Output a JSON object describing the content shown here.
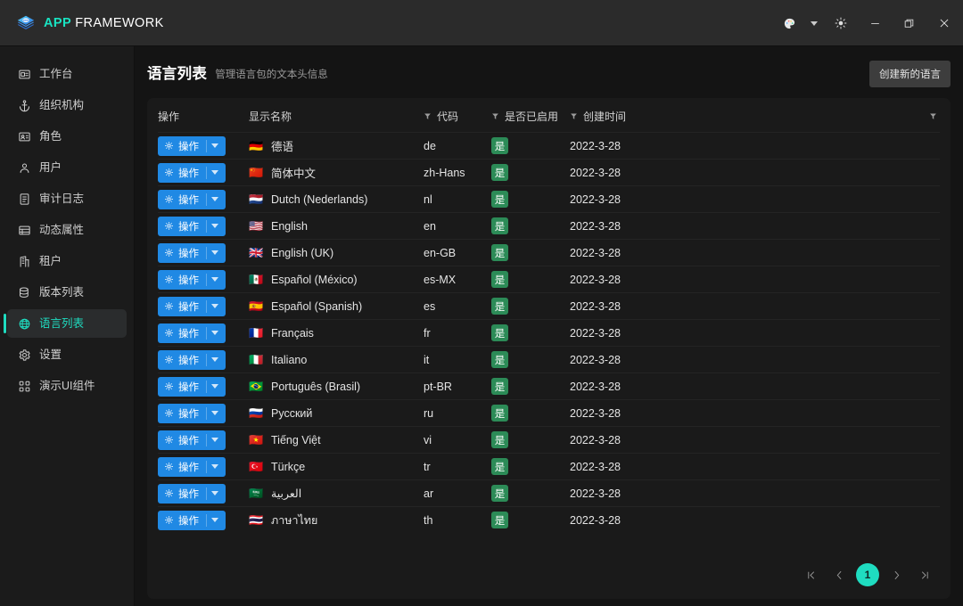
{
  "titlebar": {
    "brand_app": "APP",
    "brand_framework": "FRAMEWORK",
    "logo_icon": "layers-diamond-icon",
    "controls": [
      {
        "name": "theme-palette-button",
        "icon": "palette-icon"
      },
      {
        "name": "theme-palette-caret",
        "icon": "chevron-down-icon"
      },
      {
        "name": "brightness-button",
        "icon": "sun-icon"
      },
      {
        "name": "minimize-button",
        "icon": "minimize-icon"
      },
      {
        "name": "maximize-button",
        "icon": "maximize-icon"
      },
      {
        "name": "close-button",
        "icon": "close-icon"
      }
    ]
  },
  "sidebar": {
    "items": [
      {
        "label": "工作台",
        "icon": "dashboard-icon",
        "active": false
      },
      {
        "label": "组织机构",
        "icon": "anchor-icon",
        "active": false
      },
      {
        "label": "角色",
        "icon": "id-card-icon",
        "active": false
      },
      {
        "label": "用户",
        "icon": "user-icon",
        "active": false
      },
      {
        "label": "审计日志",
        "icon": "clipboard-icon",
        "active": false
      },
      {
        "label": "动态属性",
        "icon": "table-rows-icon",
        "active": false
      },
      {
        "label": "租户",
        "icon": "building-icon",
        "active": false
      },
      {
        "label": "版本列表",
        "icon": "database-icon",
        "active": false
      },
      {
        "label": "语言列表",
        "icon": "globe-icon",
        "active": true
      },
      {
        "label": "设置",
        "icon": "gear-icon",
        "active": false
      },
      {
        "label": "演示UI组件",
        "icon": "components-icon",
        "active": false
      }
    ]
  },
  "page": {
    "title": "语言列表",
    "subtitle": "管理语言包的文本头信息",
    "create_button": "创建新的语言"
  },
  "table": {
    "columns": [
      {
        "key": "action",
        "label": "操作",
        "filter": false
      },
      {
        "key": "name",
        "label": "显示名称",
        "filter": true
      },
      {
        "key": "code",
        "label": "代码",
        "filter": true
      },
      {
        "key": "enabled",
        "label": "是否已启用",
        "filter": true
      },
      {
        "key": "created",
        "label": "创建时间",
        "filter": false
      }
    ],
    "trailing_filter_icon": "filter-icon",
    "action_button": {
      "label": "操作",
      "icon": "gear-icon",
      "caret": "chevron-down-icon"
    },
    "rows": [
      {
        "flag": "🇩🇪",
        "name": "德语",
        "code": "de",
        "enabled": "是",
        "created": "2022-3-28"
      },
      {
        "flag": "🇨🇳",
        "name": "简体中文",
        "code": "zh-Hans",
        "enabled": "是",
        "created": "2022-3-28"
      },
      {
        "flag": "🇳🇱",
        "name": "Dutch (Nederlands)",
        "code": "nl",
        "enabled": "是",
        "created": "2022-3-28"
      },
      {
        "flag": "🇺🇸",
        "name": "English",
        "code": "en",
        "enabled": "是",
        "created": "2022-3-28"
      },
      {
        "flag": "🇬🇧",
        "name": "English (UK)",
        "code": "en-GB",
        "enabled": "是",
        "created": "2022-3-28"
      },
      {
        "flag": "🇲🇽",
        "name": "Español (México)",
        "code": "es-MX",
        "enabled": "是",
        "created": "2022-3-28"
      },
      {
        "flag": "🇪🇸",
        "name": "Español (Spanish)",
        "code": "es",
        "enabled": "是",
        "created": "2022-3-28"
      },
      {
        "flag": "🇫🇷",
        "name": "Français",
        "code": "fr",
        "enabled": "是",
        "created": "2022-3-28"
      },
      {
        "flag": "🇮🇹",
        "name": "Italiano",
        "code": "it",
        "enabled": "是",
        "created": "2022-3-28"
      },
      {
        "flag": "🇧🇷",
        "name": "Português (Brasil)",
        "code": "pt-BR",
        "enabled": "是",
        "created": "2022-3-28"
      },
      {
        "flag": "🇷🇺",
        "name": "Русский",
        "code": "ru",
        "enabled": "是",
        "created": "2022-3-28"
      },
      {
        "flag": "🇻🇳",
        "name": "Tiếng Việt",
        "code": "vi",
        "enabled": "是",
        "created": "2022-3-28"
      },
      {
        "flag": "🇹🇷",
        "name": "Türkçe",
        "code": "tr",
        "enabled": "是",
        "created": "2022-3-28"
      },
      {
        "flag": "🇸🇦",
        "name": "العربية",
        "code": "ar",
        "enabled": "是",
        "created": "2022-3-28"
      },
      {
        "flag": "🇹🇭",
        "name": "ภาษาไทย",
        "code": "th",
        "enabled": "是",
        "created": "2022-3-28"
      }
    ]
  },
  "pagination": {
    "first": "⟨⟨",
    "prev": "‹",
    "current_page": "1",
    "next": "›",
    "last": "⟩⟩"
  },
  "colors": {
    "accent_teal": "#1fdcc0",
    "action_blue": "#2089e4",
    "badge_green": "#2c8b57",
    "titlebar_bg": "#2b2b2b",
    "sidebar_bg": "#1b1b1b",
    "page_bg": "#141414",
    "card_bg": "#1a1a1a"
  }
}
